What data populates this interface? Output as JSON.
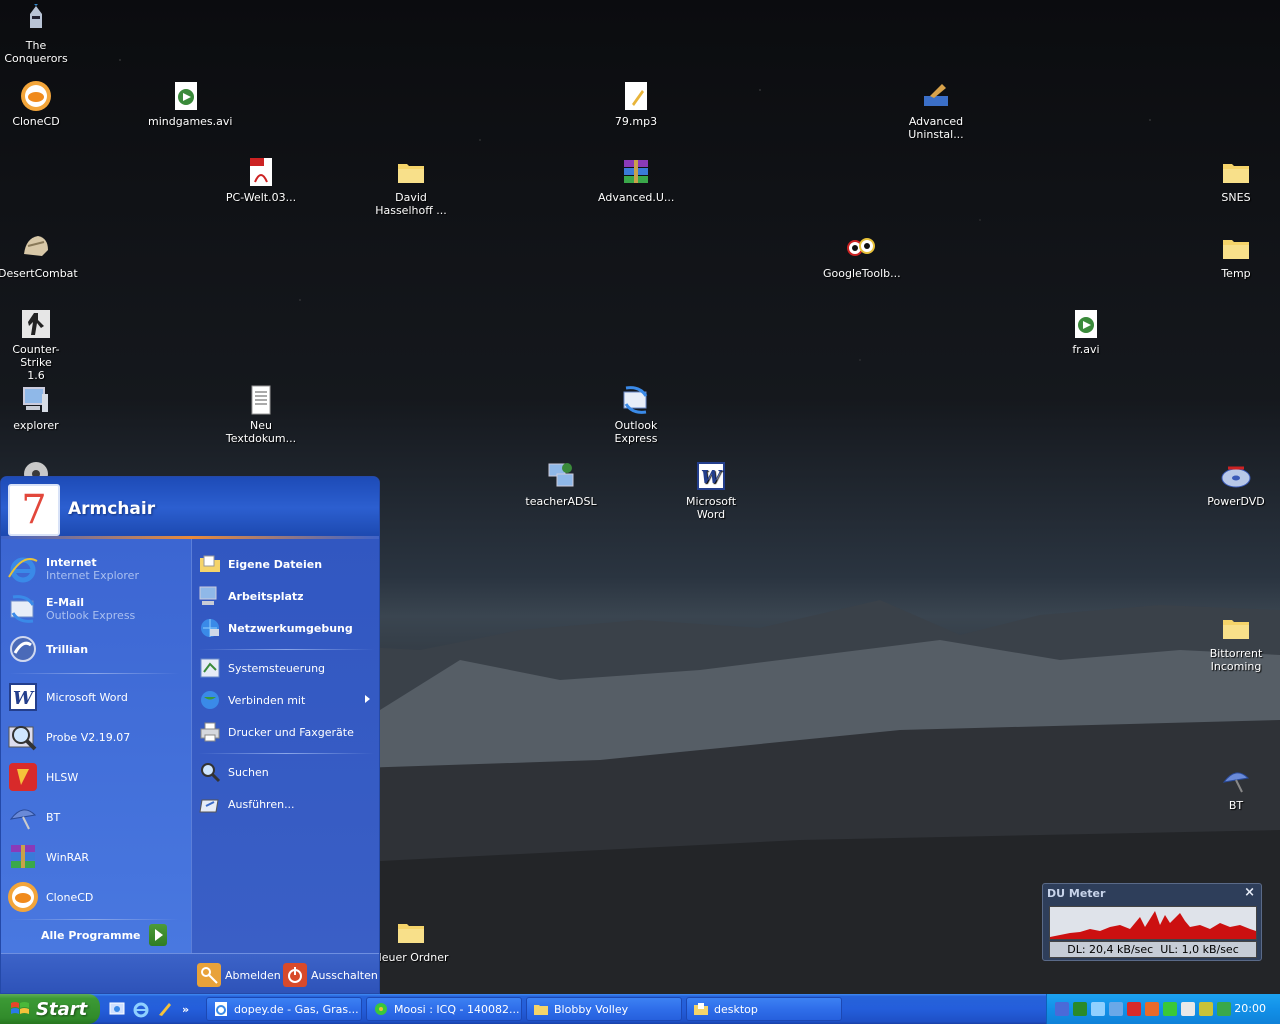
{
  "desktop": {
    "icons": {
      "conquerors": "The\nConquerors",
      "clonecd": "CloneCD",
      "mindgames": "mindgames.avi",
      "mp3": "79.mp3",
      "advanced_uninst": "Advanced\nUninstal...",
      "pcwelt": "PC-Welt.03...",
      "hasselhoff": "David\nHasselhoff ...",
      "advanced_u": "Advanced.U...",
      "snes": "SNES",
      "desertcombat": "DesertCombat",
      "googletoolbar": "GoogleToolb...",
      "temp": "Temp",
      "counterstrike": "Counter-Strike\n1.6",
      "fravi": "fr.avi",
      "explorer": "explorer",
      "textdok": "Neu\nTextdokum...",
      "outlook": "Outlook\nExpress",
      "teacheradsl": "teacherADSL",
      "msword": "Microsoft\nWord",
      "powerdvd": "PowerDVD",
      "bittorrent": "Bittorrent\nIncoming",
      "bt": "BT",
      "neuer_ordner": "Neuer Ordner"
    }
  },
  "startmenu": {
    "username": "Armchair",
    "avatar_char": "7",
    "pinned": [
      {
        "title": "Internet",
        "subtitle": "Internet Explorer"
      },
      {
        "title": "E-Mail",
        "subtitle": "Outlook Express"
      },
      {
        "title": "Trillian"
      }
    ],
    "recent": [
      "Microsoft Word",
      "Probe V2.19.07",
      "HLSW",
      "BT",
      "WinRAR",
      "CloneCD"
    ],
    "all_programs": "Alle Programme",
    "right": {
      "eigene_dateien": "Eigene Dateien",
      "arbeitsplatz": "Arbeitsplatz",
      "netzwerk": "Netzwerkumgebung",
      "systemsteuerung": "Systemsteuerung",
      "verbinden": "Verbinden mit",
      "drucker": "Drucker und Faxgeräte",
      "suchen": "Suchen",
      "ausfuehren": "Ausführen..."
    },
    "footer": {
      "logoff": "Abmelden",
      "shutdown": "Ausschalten"
    }
  },
  "taskbar": {
    "start_label": "Start",
    "more": "»",
    "tasks": [
      "dopey.de - Gas, Gras...",
      "Moosi : ICQ - 140082...",
      "Blobby Volley",
      "desktop"
    ],
    "clock": "20:00"
  },
  "dumeter": {
    "title": "DU Meter",
    "close": "×",
    "readout": "DL: 20,4 kB/sec  UL: 1,0 kB/sec",
    "graph_color": "#cc1010"
  }
}
